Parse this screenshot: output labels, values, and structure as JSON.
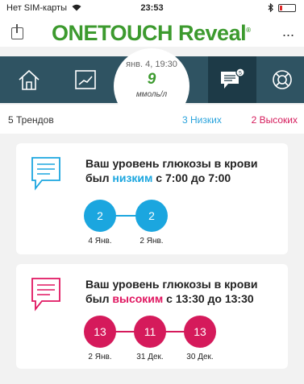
{
  "status": {
    "carrier": "Нет SIM-карты",
    "time": "23:53"
  },
  "header": {
    "logo_one": "ONETOUCH",
    "logo_reveal": "Reveal",
    "logo_tm": "®",
    "menu": "..."
  },
  "reading": {
    "date": "янв. 4, 19:30",
    "value": "9",
    "unit": "ммоль/л"
  },
  "summary": {
    "count": "5 Трендов",
    "low": "3 Низких",
    "high": "2 Высоких"
  },
  "cards": [
    {
      "pre": "Ваш уровень глюкозы в крови был ",
      "keyword": "низким",
      "post": " с 7:00 до 7:00",
      "values": [
        "2",
        "2"
      ],
      "dates": [
        "4 Янв.",
        "2 Янв."
      ]
    },
    {
      "pre": "Ваш уровень глюкозы в крови был ",
      "keyword": "высоким",
      "post": " с 13:30 до 13:30",
      "values": [
        "13",
        "11",
        "13"
      ],
      "dates": [
        "2 Янв.",
        "31 Дек.",
        "30 Дек."
      ]
    }
  ],
  "colors": {
    "low": "#1ba6df",
    "high": "#d51a5b",
    "nav": "#2f5362",
    "brand_green": "#3c9a2e"
  },
  "icons": [
    "wifi-icon",
    "bluetooth-icon",
    "battery-icon",
    "share-icon",
    "more-icon",
    "home-icon",
    "trend-chart-icon",
    "message-icon",
    "lifebuoy-icon",
    "chat-icon"
  ]
}
